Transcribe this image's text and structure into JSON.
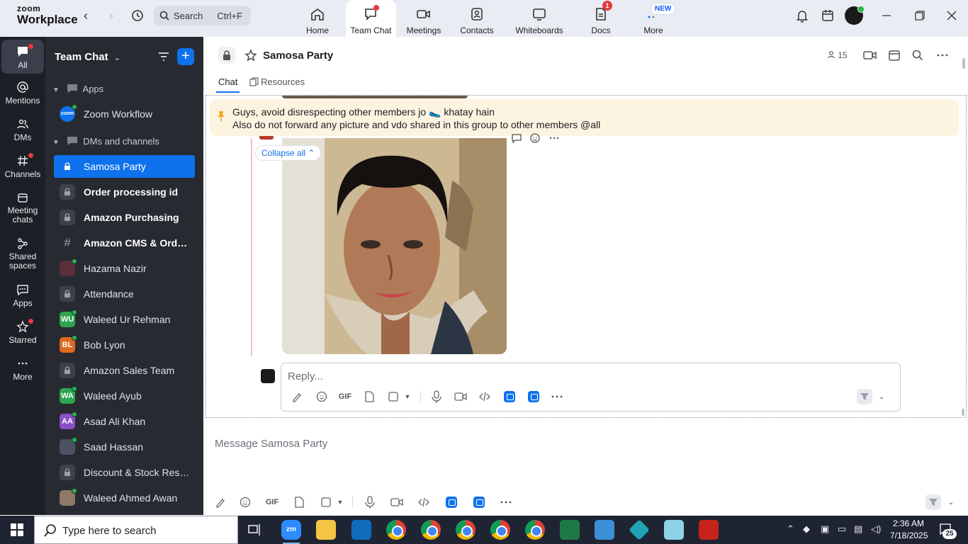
{
  "app": {
    "logo_line1": "zoom",
    "logo_line2": "Workplace",
    "search_label": "Search",
    "search_shortcut": "Ctrl+F"
  },
  "top_tabs": [
    {
      "label": "Home",
      "icon": "home-icon"
    },
    {
      "label": "Team Chat",
      "icon": "chat-icon",
      "active": true
    },
    {
      "label": "Meetings",
      "icon": "video-icon"
    },
    {
      "label": "Contacts",
      "icon": "contacts-icon"
    },
    {
      "label": "Whiteboards",
      "icon": "whiteboard-icon"
    },
    {
      "label": "Docs",
      "icon": "docs-icon",
      "badge": "1"
    },
    {
      "label": "More",
      "icon": "more-icon",
      "badge": "NEW"
    }
  ],
  "rail": [
    {
      "label": "All",
      "icon": "chat-bubble-icon",
      "active": true
    },
    {
      "label": "Mentions",
      "icon": "at-icon"
    },
    {
      "label": "DMs",
      "icon": "people-icon"
    },
    {
      "label": "Channels",
      "icon": "hash-icon"
    },
    {
      "label": "Meeting chats",
      "icon": "calendar-icon"
    },
    {
      "label": "Shared spaces",
      "icon": "share-icon"
    },
    {
      "label": "Apps",
      "icon": "apps-icon"
    },
    {
      "label": "Starred",
      "icon": "star-icon"
    },
    {
      "label": "More",
      "icon": "ellipsis-icon"
    }
  ],
  "sidebar": {
    "title": "Team Chat",
    "section_apps": "Apps",
    "app_item": "Zoom Workflow",
    "section_dms": "DMs and channels",
    "items": [
      {
        "label": "Samosa Party",
        "type": "lock",
        "selected": true
      },
      {
        "label": "Order processing id",
        "type": "lock",
        "bold": true
      },
      {
        "label": "Amazon Purchasing",
        "type": "lock",
        "bold": true
      },
      {
        "label": "Amazon CMS & Order...",
        "type": "hash",
        "bold": true
      },
      {
        "label": "Hazama Nazir",
        "type": "photo",
        "color": "#5a2e3a"
      },
      {
        "label": "Attendance",
        "type": "lock"
      },
      {
        "label": "Waleed Ur Rehman",
        "type": "init",
        "initials": "WU",
        "color": "#2ea44f"
      },
      {
        "label": "Bob Lyon",
        "type": "init",
        "initials": "BL",
        "color": "#e0681f"
      },
      {
        "label": "Amazon Sales Team",
        "type": "lock"
      },
      {
        "label": "Waleed Ayub",
        "type": "init",
        "initials": "WA",
        "color": "#2ea44f"
      },
      {
        "label": "Asad Ali Khan",
        "type": "init",
        "initials": "AA",
        "color": "#8a4fc7"
      },
      {
        "label": "Saad Hassan",
        "type": "photo",
        "color": "#4a5160"
      },
      {
        "label": "Discount & Stock Reser...",
        "type": "lock"
      },
      {
        "label": "Waleed Ahmed Awan",
        "type": "photo",
        "color": "#8c7a66"
      }
    ]
  },
  "channel": {
    "name": "Samosa Party",
    "members": "15",
    "tab_chat": "Chat",
    "tab_resources": "Resources",
    "pinned_line1": "Guys, avoid disrespecting other members jo 🥿 khatay hain",
    "pinned_line2": "Also do not forward any picture and vdo shared in this group to other members @all",
    "collapse_label": "Collapse all",
    "reply_placeholder": "Reply...",
    "compose_placeholder": "Message Samosa Party",
    "gif_label": "GIF"
  },
  "taskbar": {
    "search_placeholder": "Type here to search",
    "time": "2:36 AM",
    "date": "7/18/2025",
    "notifications": "25"
  }
}
